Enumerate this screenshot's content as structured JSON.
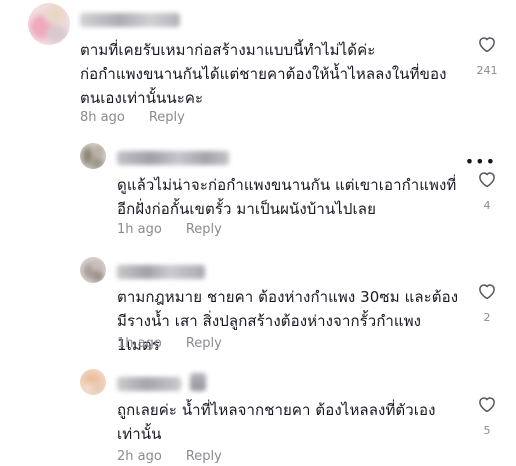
{
  "comments": [
    {
      "text": "ตามที่เคยรับเหมาก่อสร้างมาแบบนี้ทำไม่ได้ค่ะ\nก่อกำแพงขนานกันได้แต่ชายคาต้องให้น้ำไหลลงในที่ของ\nตนเองเท่านั้นนะคะ",
      "time": "8h ago",
      "reply": "Reply",
      "likes": "241"
    },
    {
      "text": "ดูแล้วไม่น่าจะก่อกำแพงขนานกัน แต่เขาเอากำแพงที่\nอีกฝั่งก่อกั้นเขตรั้ว มาเป็นผนังบ้านไปเลย",
      "time": "1h ago",
      "reply": "Reply",
      "likes": "4"
    },
    {
      "text": "ตามกฎหมาย ชายคา ต้องห่างกำแพง 30ซม และต้อง\nมีรางน้ำ เสา สิ่งปลูกสร้างต้องห่างจากรั้วกำแพง 1เมตร",
      "time": "1h ago",
      "reply": "Reply",
      "likes": "2"
    },
    {
      "text": "ถูกเลยค่ะ น้ำที่ไหลจากชายคา ต้องไหลลงที่ตัวเอง\nเท่านั้น",
      "time": "2h ago",
      "reply": "Reply",
      "likes": "5"
    }
  ],
  "more_menu": "•••",
  "icons": {
    "like": "heart-outline-icon",
    "more": "more-dots-icon"
  },
  "colors": {
    "text": "#161823",
    "meta": "#8a8b91"
  }
}
